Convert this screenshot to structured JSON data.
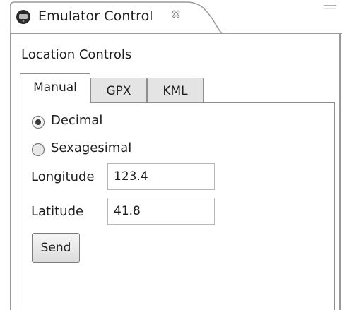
{
  "view": {
    "title": "Emulator Control",
    "icon": "emulator-phone-icon",
    "close_icon": "close-icon",
    "menu_icon": "view-menu-icon"
  },
  "section": {
    "label": "Location Controls"
  },
  "tabs": [
    {
      "label": "Manual",
      "active": true
    },
    {
      "label": "GPX",
      "active": false
    },
    {
      "label": "KML",
      "active": false
    }
  ],
  "manual": {
    "format_options": [
      {
        "label": "Decimal",
        "selected": true
      },
      {
        "label": "Sexagesimal",
        "selected": false
      }
    ],
    "longitude": {
      "label": "Longitude",
      "value": "123.4"
    },
    "latitude": {
      "label": "Latitude",
      "value": "41.8"
    },
    "send_label": "Send"
  },
  "colors": {
    "border": "#9a9a9a",
    "tab_inactive": "#e4e4e4",
    "text": "#1e1e1e"
  }
}
